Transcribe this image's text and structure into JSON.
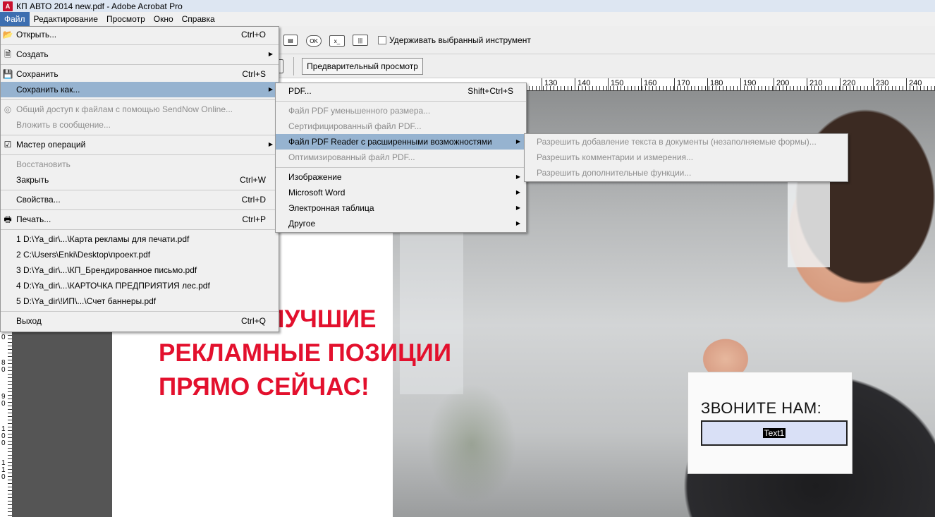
{
  "window": {
    "title": "КП АВТО 2014 new.pdf - Adobe Acrobat Pro",
    "app_icon": "acrobat-icon"
  },
  "menubar": [
    "Файл",
    "Редактирование",
    "Просмотр",
    "Окно",
    "Справка"
  ],
  "toolbar": {
    "keep_tool_label": "Удерживать выбранный инструмент",
    "preview_label": "Предварительный просмотр",
    "ok_label": "OK"
  },
  "ruler": {
    "labels": [
      "130",
      "140",
      "150",
      "160",
      "170",
      "180",
      "190",
      "200",
      "210",
      "220",
      "230",
      "240"
    ]
  },
  "vruler": {
    "labels": [
      "0",
      "8",
      "0",
      "9",
      "0",
      "1",
      "0",
      "0",
      "1",
      "1",
      "0"
    ]
  },
  "file_menu": {
    "items": [
      {
        "label": "Открыть...",
        "shortcut": "Ctrl+O",
        "icon": "open-folder-icon"
      },
      {
        "label": "Создать",
        "submenu": true,
        "icon": "create-icon"
      },
      {
        "label": "Сохранить",
        "shortcut": "Ctrl+S",
        "icon": "save-icon"
      },
      {
        "label": "Сохранить как...",
        "submenu": true,
        "highlighted": true
      },
      {
        "label": "Общий доступ к файлам с помощью SendNow Online...",
        "disabled": true,
        "icon": "share-icon"
      },
      {
        "label": "Вложить в сообщение...",
        "disabled": true
      },
      {
        "label": "Мастер операций",
        "submenu": true,
        "icon": "wizard-icon"
      },
      {
        "label": "Восстановить",
        "disabled": true
      },
      {
        "label": "Закрыть",
        "shortcut": "Ctrl+W"
      },
      {
        "label": "Свойства...",
        "shortcut": "Ctrl+D"
      },
      {
        "label": "Печать...",
        "shortcut": "Ctrl+P",
        "icon": "print-icon"
      },
      {
        "label": "1 D:\\Ya_dir\\...\\Карта рекламы для печати.pdf"
      },
      {
        "label": "2 C:\\Users\\Enki\\Desktop\\проект.pdf"
      },
      {
        "label": "3 D:\\Ya_dir\\...\\КП_Брендированное письмо.pdf"
      },
      {
        "label": "4 D:\\Ya_dir\\...\\КАРТОЧКА ПРЕДПРИЯТИЯ лес.pdf"
      },
      {
        "label": "5 D:\\Ya_dir\\!ИП\\...\\Счет баннеры.pdf"
      },
      {
        "label": "Выход",
        "shortcut": "Ctrl+Q"
      }
    ]
  },
  "saveas_menu": {
    "items": [
      {
        "label": "PDF...",
        "shortcut": "Shift+Ctrl+S"
      },
      {
        "label": "Файл PDF уменьшенного размера...",
        "disabled": true
      },
      {
        "label": "Сертифицированный файл PDF...",
        "disabled": true
      },
      {
        "label": "Файл PDF Reader с расширенными возможностями",
        "submenu": true,
        "highlighted": true
      },
      {
        "label": "Оптимизированный файл PDF...",
        "disabled": true
      },
      {
        "label": "Изображение",
        "submenu": true
      },
      {
        "label": "Microsoft Word",
        "submenu": true
      },
      {
        "label": "Электронная таблица",
        "submenu": true
      },
      {
        "label": "Другое",
        "submenu": true
      }
    ]
  },
  "reader_menu": {
    "items": [
      {
        "label": "Разрешить добавление текста в документы (незаполняемые формы)...",
        "disabled": true
      },
      {
        "label": "Разрешить комментарии и измерения...",
        "disabled": true
      },
      {
        "label": "Разрешить дополнительные функции...",
        "disabled": true
      }
    ]
  },
  "document": {
    "headline": [
      "ЗАНЯТЬ ЛУЧШИЕ",
      "РЕКЛАМНЫЕ ПОЗИЦИИ",
      "ПРЯМО СЕЙЧАС!"
    ],
    "card_title": "ЗВОНИТЕ НАМ:",
    "card_field": "Text1",
    "headline_color": "#e3102d"
  }
}
